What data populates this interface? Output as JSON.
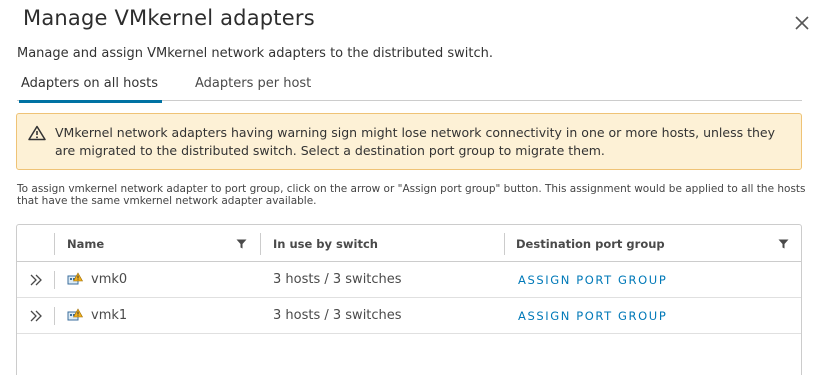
{
  "dialog": {
    "title": "Manage VMkernel adapters",
    "subtitle": "Manage and assign VMkernel network adapters to the distributed switch."
  },
  "tabs": [
    {
      "label": "Adapters on all hosts",
      "active": true
    },
    {
      "label": "Adapters per host",
      "active": false
    }
  ],
  "alert": {
    "icon": "warning-triangle-icon",
    "text": "VMkernel network adapters having warning sign might lose network connectivity in one or more hosts, unless they are migrated to the distributed switch. Select a destination port group to migrate them.",
    "colors": {
      "background": "#fdf1d6",
      "border": "#efc376"
    }
  },
  "help_text": "To assign vmkernel network adapter to port group, click on the arrow or \"Assign port group\" button. This assignment would be applied to all the hosts that have the same vmkernel network adapter available.",
  "grid": {
    "columns": [
      "Name",
      "In use by switch",
      "Destination port group"
    ],
    "rows": [
      {
        "name": "vmk0",
        "in_use": "3 hosts / 3 switches",
        "action": "ASSIGN PORT GROUP"
      },
      {
        "name": "vmk1",
        "in_use": "3 hosts / 3 switches",
        "action": "ASSIGN PORT GROUP"
      }
    ]
  },
  "colors": {
    "accent": "#0079b8",
    "tab_underline": "#0072a3"
  }
}
